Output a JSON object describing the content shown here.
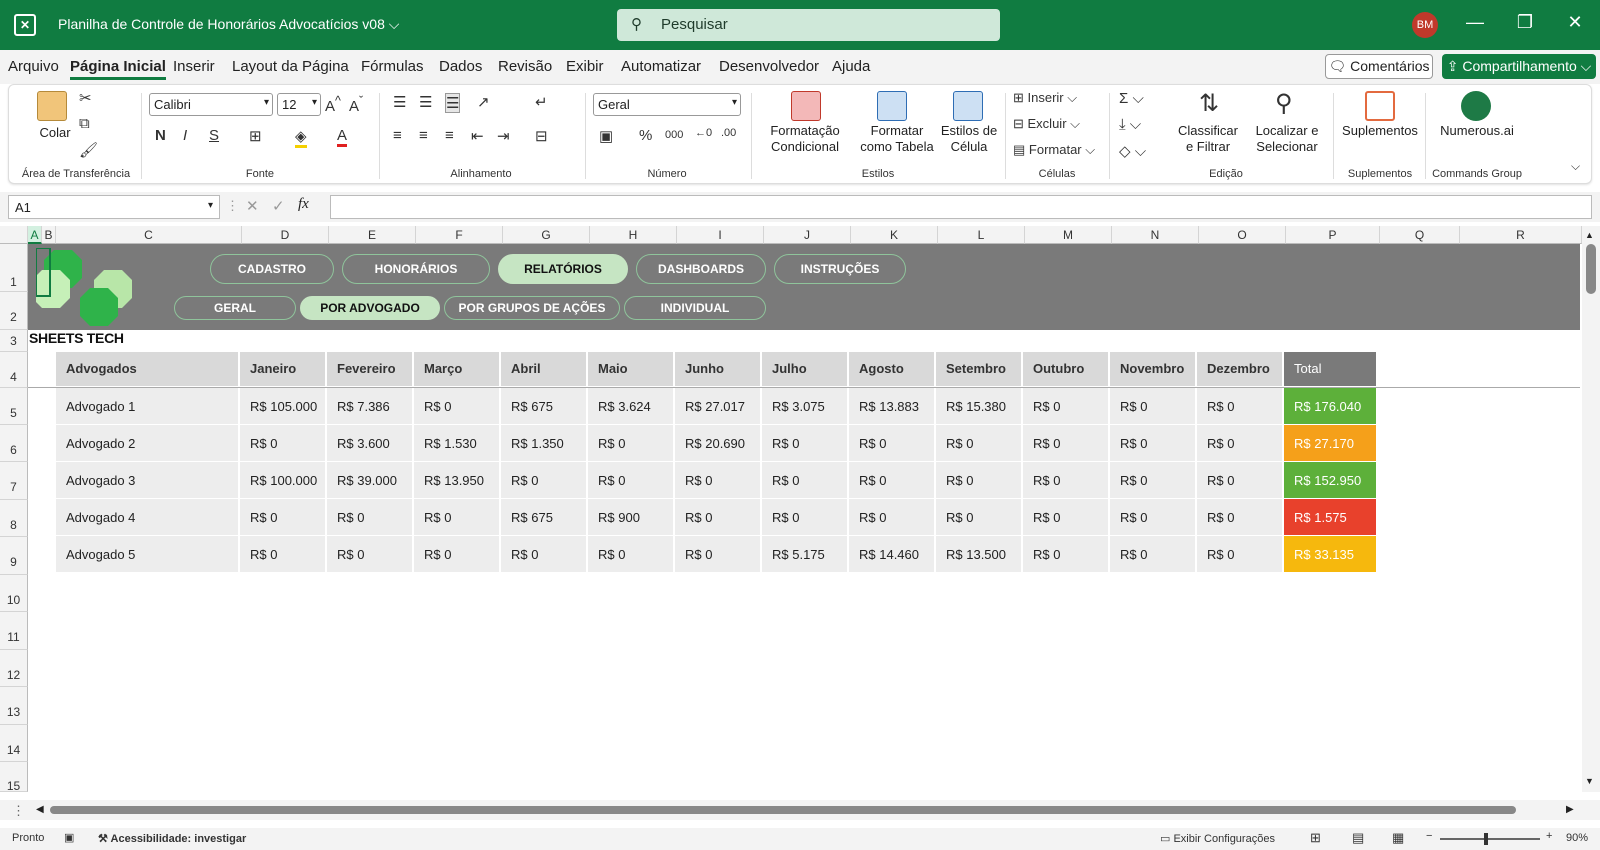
{
  "window": {
    "title": "Planilha de Controle de Honorários Advocatícios v08",
    "title_caret": "⌵",
    "search_placeholder": "Pesquisar",
    "user_initials": "BM"
  },
  "menu": {
    "items": [
      "Arquivo",
      "Página Inicial",
      "Inserir",
      "Layout da Página",
      "Fórmulas",
      "Dados",
      "Revisão",
      "Exibir",
      "Automatizar",
      "Desenvolvedor",
      "Ajuda"
    ],
    "active": "Página Inicial",
    "comments": "Comentários",
    "share": "Compartilhamento"
  },
  "ribbon": {
    "clipboard": {
      "paste": "Colar",
      "group": "Área de Transferência"
    },
    "font": {
      "name": "Calibri",
      "size": "12",
      "bold": "N",
      "italic": "I",
      "underline": "S",
      "group": "Fonte"
    },
    "alignment": {
      "group": "Alinhamento"
    },
    "number": {
      "format": "Geral",
      "percent": "%",
      "thousands": "000",
      "group": "Número"
    },
    "styles": {
      "conditional": "Formatação Condicional",
      "table": "Formatar como Tabela",
      "cell": "Estilos de Célula",
      "group": "Estilos"
    },
    "cells": {
      "insert": "Inserir",
      "delete": "Excluir",
      "format": "Formatar",
      "group": "Células"
    },
    "editing": {
      "sort": "Classificar e Filtrar",
      "find": "Localizar e Selecionar",
      "group": "Edição"
    },
    "addins": {
      "label": "Suplementos",
      "group": "Suplementos"
    },
    "numerous": {
      "label": "Numerous.ai",
      "group": "Commands Group"
    }
  },
  "formula_bar": {
    "name_box": "A1",
    "fx": "fx",
    "value": ""
  },
  "columns": [
    "A",
    "B",
    "C",
    "D",
    "E",
    "F",
    "G",
    "H",
    "I",
    "J",
    "K",
    "L",
    "M",
    "N",
    "O",
    "P",
    "Q",
    "R"
  ],
  "rows": [
    "1",
    "2",
    "3",
    "4",
    "5",
    "6",
    "7",
    "8",
    "9",
    "10",
    "11",
    "12",
    "13",
    "14",
    "15"
  ],
  "sheet": {
    "brand": "SHEETS TECH",
    "nav_main": [
      "CADASTRO",
      "HONORÁRIOS",
      "RELATÓRIOS",
      "DASHBOARDS",
      "INSTRUÇÕES"
    ],
    "nav_main_active": "RELATÓRIOS",
    "nav_sub": [
      "GERAL",
      "POR ADVOGADO",
      "POR GRUPOS DE AÇÕES",
      "INDIVIDUAL"
    ],
    "nav_sub_active": "POR ADVOGADO",
    "table": {
      "headers": [
        "Advogados",
        "Janeiro",
        "Fevereiro",
        "Março",
        "Abril",
        "Maio",
        "Junho",
        "Julho",
        "Agosto",
        "Setembro",
        "Outubro",
        "Novembro",
        "Dezembro",
        "Total"
      ],
      "rows": [
        {
          "name": "Advogado 1",
          "months": [
            "R$ 105.000",
            "R$ 7.386",
            "R$ 0",
            "R$ 675",
            "R$ 3.624",
            "R$ 27.017",
            "R$ 3.075",
            "R$ 13.883",
            "R$ 15.380",
            "R$ 0",
            "R$ 0",
            "R$ 0"
          ],
          "total": "R$ 176.040",
          "total_color": "#5db03a"
        },
        {
          "name": "Advogado 2",
          "months": [
            "R$ 0",
            "R$ 3.600",
            "R$ 1.530",
            "R$ 1.350",
            "R$ 0",
            "R$ 20.690",
            "R$ 0",
            "R$ 0",
            "R$ 0",
            "R$ 0",
            "R$ 0",
            "R$ 0"
          ],
          "total": "R$ 27.170",
          "total_color": "#f5a01a"
        },
        {
          "name": "Advogado 3",
          "months": [
            "R$ 100.000",
            "R$ 39.000",
            "R$ 13.950",
            "R$ 0",
            "R$ 0",
            "R$ 0",
            "R$ 0",
            "R$ 0",
            "R$ 0",
            "R$ 0",
            "R$ 0",
            "R$ 0"
          ],
          "total": "R$ 152.950",
          "total_color": "#5db03a"
        },
        {
          "name": "Advogado 4",
          "months": [
            "R$ 0",
            "R$ 0",
            "R$ 0",
            "R$ 675",
            "R$ 900",
            "R$ 0",
            "R$ 0",
            "R$ 0",
            "R$ 0",
            "R$ 0",
            "R$ 0",
            "R$ 0"
          ],
          "total": "R$ 1.575",
          "total_color": "#e8412c"
        },
        {
          "name": "Advogado 5",
          "months": [
            "R$ 0",
            "R$ 0",
            "R$ 0",
            "R$ 0",
            "R$ 0",
            "R$ 0",
            "R$ 5.175",
            "R$ 14.460",
            "R$ 13.500",
            "R$ 0",
            "R$ 0",
            "R$ 0"
          ],
          "total": "R$ 33.135",
          "total_color": "#f6b80d"
        }
      ]
    }
  },
  "status": {
    "ready": "Pronto",
    "accessibility": "Acessibilidade: investigar",
    "display_settings": "Exibir Configurações",
    "zoom": "90%"
  },
  "colors": {
    "brand_green": "#107c41",
    "banner_gray": "#7a7a7a",
    "active_pill": "#c6e5c3"
  }
}
